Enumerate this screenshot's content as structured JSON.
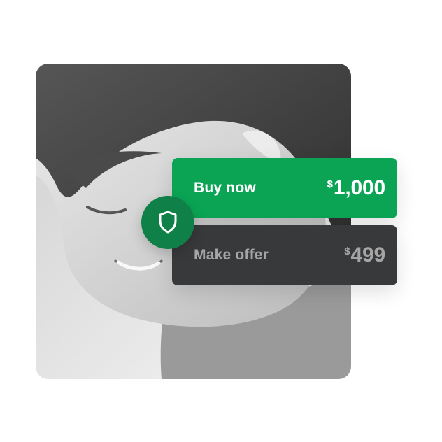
{
  "photo": {
    "icon": "person-photo-icon"
  },
  "security_badge": {
    "icon": "shield-icon",
    "color": "#0f8047"
  },
  "buy_now": {
    "label": "Buy now",
    "currency_symbol": "$",
    "price": "1,000",
    "color": "#0aa454"
  },
  "make_offer": {
    "label": "Make offer",
    "currency_symbol": "$",
    "price": "499",
    "color": "#38393b"
  }
}
